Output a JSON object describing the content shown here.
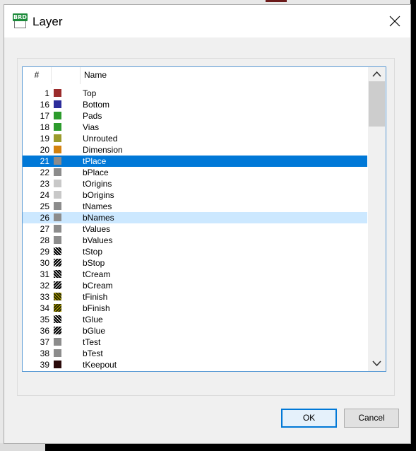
{
  "window": {
    "title": "Layer",
    "icon": "BRD"
  },
  "header": {
    "num": "#",
    "name": "Name"
  },
  "layers": [
    {
      "num": "1",
      "name": "Top",
      "color": "#9b2c2c",
      "pattern": "solid"
    },
    {
      "num": "16",
      "name": "Bottom",
      "color": "#2c2c9b",
      "pattern": "solid"
    },
    {
      "num": "17",
      "name": "Pads",
      "color": "#2c9b2c",
      "pattern": "solid"
    },
    {
      "num": "18",
      "name": "Vias",
      "color": "#2c9b2c",
      "pattern": "solid"
    },
    {
      "num": "19",
      "name": "Unrouted",
      "color": "#9b9b2c",
      "pattern": "solid"
    },
    {
      "num": "20",
      "name": "Dimension",
      "color": "#d4820e",
      "pattern": "solid"
    },
    {
      "num": "21",
      "name": "tPlace",
      "color": "#8c8c8c",
      "pattern": "solid"
    },
    {
      "num": "22",
      "name": "bPlace",
      "color": "#8c8c8c",
      "pattern": "solid"
    },
    {
      "num": "23",
      "name": "tOrigins",
      "color": "#c8c8c8",
      "pattern": "solid"
    },
    {
      "num": "24",
      "name": "bOrigins",
      "color": "#c8c8c8",
      "pattern": "solid"
    },
    {
      "num": "25",
      "name": "tNames",
      "color": "#8c8c8c",
      "pattern": "solid"
    },
    {
      "num": "26",
      "name": "bNames",
      "color": "#8c8c8c",
      "pattern": "solid"
    },
    {
      "num": "27",
      "name": "tValues",
      "color": "#8c8c8c",
      "pattern": "solid"
    },
    {
      "num": "28",
      "name": "bValues",
      "color": "#8c8c8c",
      "pattern": "solid"
    },
    {
      "num": "29",
      "name": "tStop",
      "color": "#000000",
      "pattern": "hatch"
    },
    {
      "num": "30",
      "name": "bStop",
      "color": "#000000",
      "pattern": "hatch-back"
    },
    {
      "num": "31",
      "name": "tCream",
      "color": "#000000",
      "pattern": "hatch"
    },
    {
      "num": "32",
      "name": "bCream",
      "color": "#000000",
      "pattern": "hatch-back"
    },
    {
      "num": "33",
      "name": "tFinish",
      "color": "#2c2c00",
      "pattern": "hatch-yellow"
    },
    {
      "num": "34",
      "name": "bFinish",
      "color": "#2c2c00",
      "pattern": "hatch-yellow-back"
    },
    {
      "num": "35",
      "name": "tGlue",
      "color": "#000000",
      "pattern": "hatch"
    },
    {
      "num": "36",
      "name": "bGlue",
      "color": "#000000",
      "pattern": "hatch-back"
    },
    {
      "num": "37",
      "name": "tTest",
      "color": "#8c8c8c",
      "pattern": "solid"
    },
    {
      "num": "38",
      "name": "bTest",
      "color": "#8c8c8c",
      "pattern": "solid"
    },
    {
      "num": "39",
      "name": "tKeepout",
      "color": "#2a0a0a",
      "pattern": "solid"
    }
  ],
  "selected_index": 6,
  "hover_index": 11,
  "colors": {
    "selection": "#0078d7",
    "hover": "#cce8ff",
    "list_border": "#5b9bd5"
  },
  "buttons": {
    "ok": "OK",
    "cancel": "Cancel"
  }
}
